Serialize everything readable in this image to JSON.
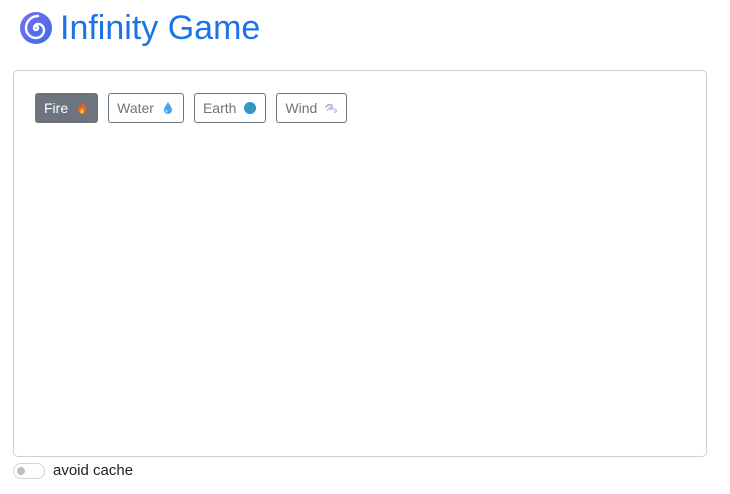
{
  "header": {
    "title": "Infinity Game",
    "logo_icon": "spiral-icon",
    "title_color": "#1a73e8"
  },
  "elements": [
    {
      "label": "Fire",
      "icon": "fire-emoji",
      "active": true
    },
    {
      "label": "Water",
      "icon": "droplet-emoji",
      "active": false
    },
    {
      "label": "Earth",
      "icon": "globe-emoji",
      "active": false
    },
    {
      "label": "Wind",
      "icon": "wind-emoji",
      "active": false
    }
  ],
  "footer": {
    "toggle_label": "avoid cache",
    "toggle_on": false
  }
}
